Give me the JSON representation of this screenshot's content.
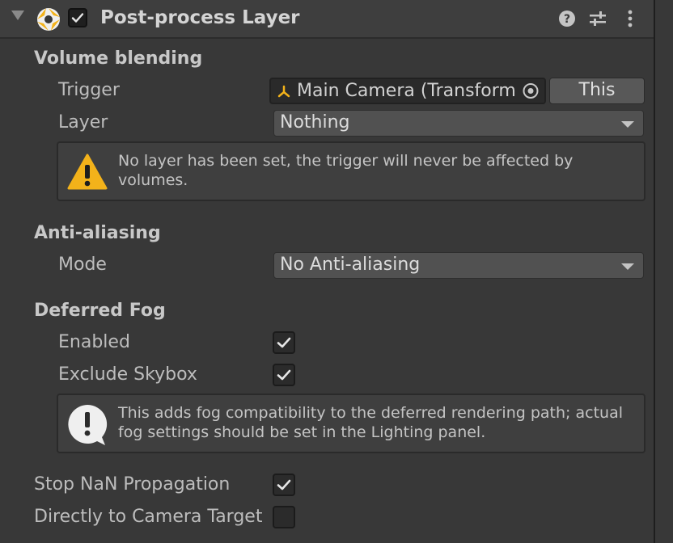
{
  "header": {
    "title": "Post-process Layer",
    "enabled": true,
    "icons": {
      "foldout": "foldout-expanded-icon",
      "component": "camera-aperture-icon",
      "help": "help-icon",
      "presets": "presets-sliders-icon",
      "menu": "kebab-menu-icon"
    }
  },
  "volume_blending": {
    "section_label": "Volume blending",
    "trigger_label": "Trigger",
    "trigger_value": "Main Camera (Transform)",
    "this_button": "This",
    "layer_label": "Layer",
    "layer_value": "Nothing",
    "warning": "No layer has been set, the trigger will never be affected by volumes."
  },
  "anti_aliasing": {
    "section_label": "Anti-aliasing",
    "mode_label": "Mode",
    "mode_value": "No Anti-aliasing"
  },
  "deferred_fog": {
    "section_label": "Deferred Fog",
    "enabled_label": "Enabled",
    "enabled": true,
    "exclude_skybox_label": "Exclude Skybox",
    "exclude_skybox": true,
    "info": "This adds fog compatibility to the deferred rendering path; actual fog settings should be set in the Lighting panel."
  },
  "misc": {
    "stop_nan_label": "Stop NaN Propagation",
    "stop_nan": true,
    "direct_label": "Directly to Camera Target",
    "direct": false
  },
  "colors": {
    "panel_bg": "#383838",
    "warning_yellow": "#f3b21a",
    "checkmark": "#e6e6e6"
  }
}
